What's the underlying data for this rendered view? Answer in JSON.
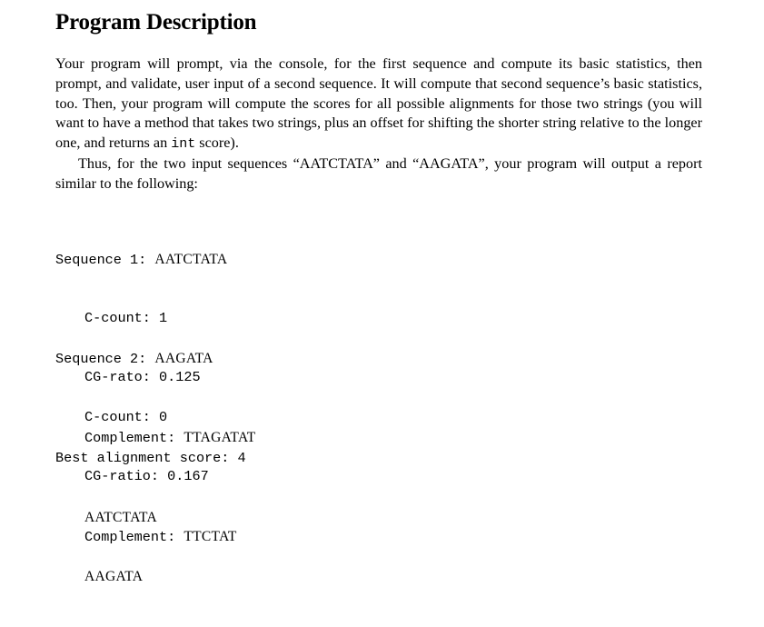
{
  "title": "Program Description",
  "paragraphs": {
    "p1_before_code": "Your program will prompt, via the console, for the first sequence and compute its basic statistics, then prompt, and validate, user input of a second sequence. It will compute that second sequence’s basic statistics, too.  Then, your program will compute the scores for all possible alignments for those two strings (you will want to have a method that takes two strings, plus an offset for shifting the shorter string relative to the longer one, and returns an ",
    "p1_code": "int",
    "p1_after_code": " score).",
    "p2": "Thus, for the two input sequences “AATCTATA” and “AAGATA”, your program will output a report similar to the following:"
  },
  "report": {
    "sequence1": {
      "label": "Sequence 1: ",
      "value": "AATCTATA",
      "c_count_label": "C-count: ",
      "c_count": "1",
      "cg_label": "CG-rato: ",
      "cg_value": "0.125",
      "complement_label": "Complement: ",
      "complement": "TTAGATAT"
    },
    "sequence2": {
      "label": "Sequence 2: ",
      "value": "AAGATA",
      "c_count_label": "C-count: ",
      "c_count": "0",
      "cg_label": "CG-ratio: ",
      "cg_value": "0.167",
      "complement_label": "Complement: ",
      "complement": "TTCTAT"
    },
    "alignment": {
      "label": "Best alignment score: ",
      "score": "4",
      "line1": "AATCTATA",
      "line2": "AAGATA"
    }
  }
}
